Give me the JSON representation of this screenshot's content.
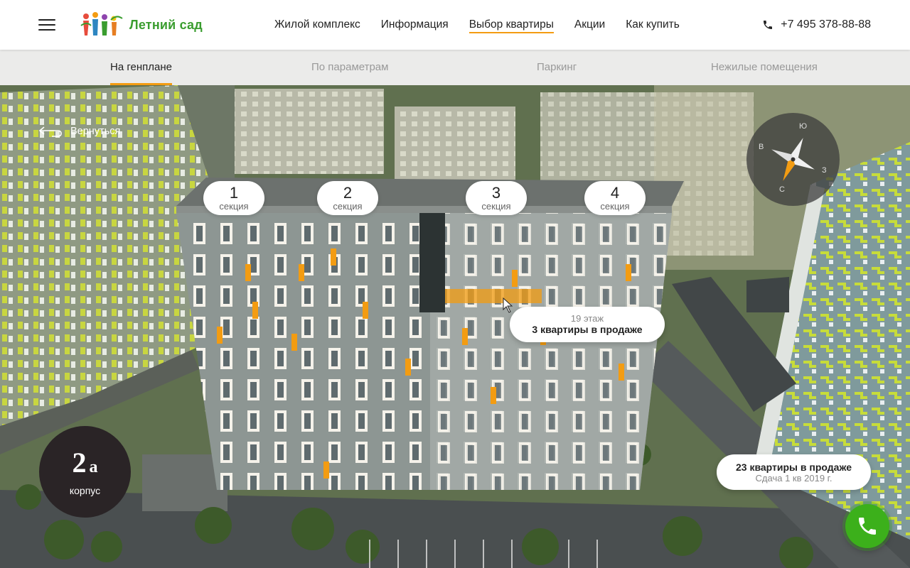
{
  "header": {
    "logo_text": "Летний сад",
    "menu_icon": "hamburger-icon",
    "nav": [
      {
        "label": "Жилой комплекс",
        "active": false
      },
      {
        "label": "Информация",
        "active": false
      },
      {
        "label": "Выбор квартиры",
        "active": true
      },
      {
        "label": "Акции",
        "active": false
      },
      {
        "label": "Как купить",
        "active": false
      }
    ],
    "phone": "+7 495 378-88-88",
    "phone_icon": "phone-icon"
  },
  "subnav": {
    "items": [
      {
        "label": "На генплане",
        "active": true
      },
      {
        "label": "По параметрам",
        "active": false
      },
      {
        "label": "Паркинг",
        "active": false
      },
      {
        "label": "Нежилые помещения",
        "active": false
      }
    ]
  },
  "back": {
    "label": "Вернуться",
    "icon": "back-arrow-icon"
  },
  "sections": [
    {
      "number": "1",
      "label": "секция"
    },
    {
      "number": "2",
      "label": "секция"
    },
    {
      "number": "3",
      "label": "секция"
    },
    {
      "number": "4",
      "label": "секция"
    }
  ],
  "floor_tooltip": {
    "floor": "19 этаж",
    "sale": "3 квартиры в продаже"
  },
  "compass": {
    "n": "Ю",
    "w": "В",
    "e": "З",
    "s": "С"
  },
  "building": {
    "number": "2",
    "letter": "а",
    "label": "корпус"
  },
  "sale_tooltip": {
    "count": "23 квартиры в продаже",
    "delivery": "Сдача 1 кв 2019 г."
  },
  "colors": {
    "accent": "#f39c12",
    "brand_green": "#3a9d2f",
    "call_green": "#3cb01b"
  }
}
